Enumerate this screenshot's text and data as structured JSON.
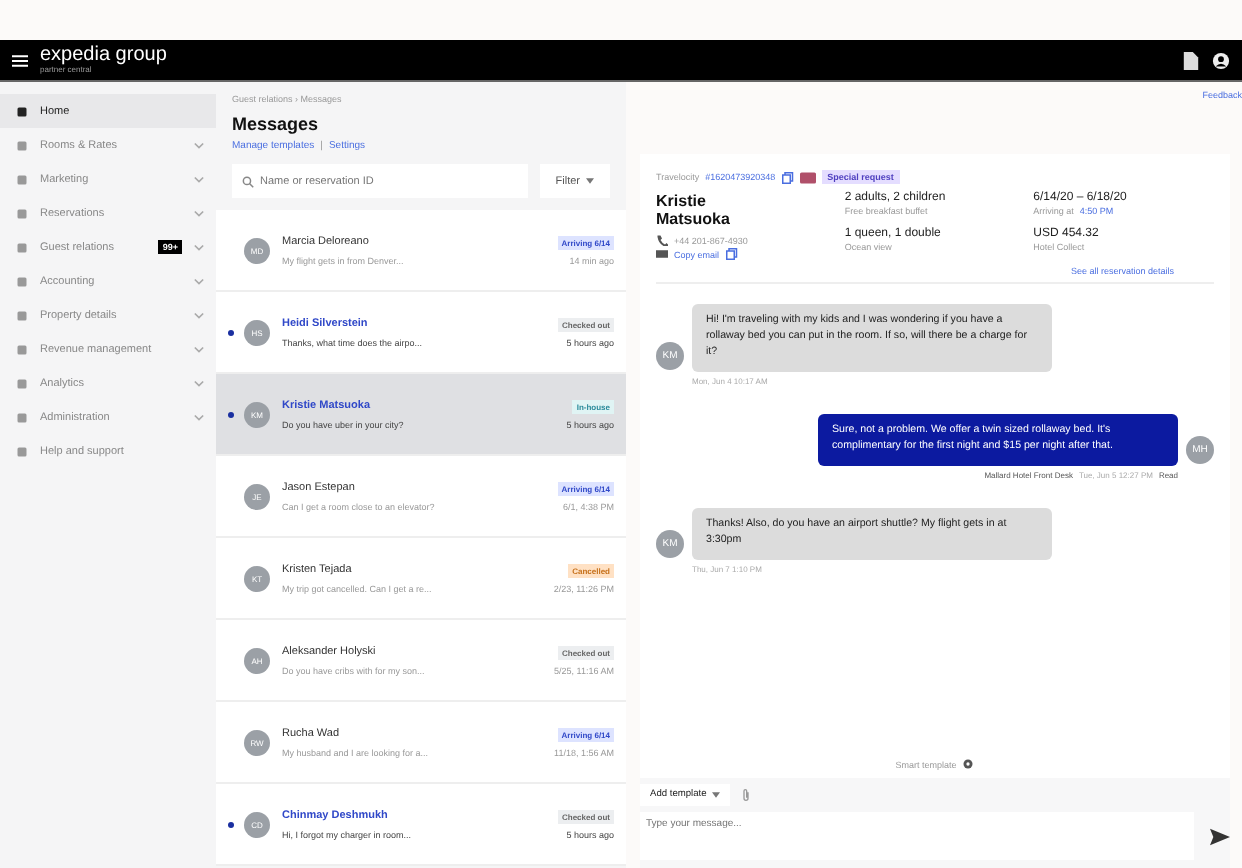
{
  "header": {
    "brand": "expedia group",
    "subtitle": "partner central"
  },
  "sidebar": {
    "items": [
      {
        "label": "Home",
        "selected": true,
        "expandable": false
      },
      {
        "label": "Rooms & Rates",
        "selected": false,
        "expandable": true
      },
      {
        "label": "Marketing",
        "selected": false,
        "expandable": true
      },
      {
        "label": "Reservations",
        "selected": false,
        "expandable": true
      },
      {
        "label": "Guest relations",
        "selected": false,
        "expandable": true,
        "badge": "99+"
      },
      {
        "label": "Accounting",
        "selected": false,
        "expandable": true
      },
      {
        "label": "Property details",
        "selected": false,
        "expandable": true
      },
      {
        "label": "Revenue management",
        "selected": false,
        "expandable": true
      },
      {
        "label": "Analytics",
        "selected": false,
        "expandable": true
      },
      {
        "label": "Administration",
        "selected": false,
        "expandable": true
      },
      {
        "label": "Help and support",
        "selected": false,
        "expandable": false
      }
    ]
  },
  "breadcrumb": "Guest relations › Messages",
  "feedback": "Feedback",
  "page_title": "Messages",
  "links": [
    "Manage templates",
    "Settings"
  ],
  "links_separator": "|",
  "search": {
    "placeholder": "Name or reservation ID"
  },
  "filter": "Filter",
  "conversations": [
    {
      "initials": "MD",
      "name": "Marcia Deloreano",
      "preview": "My flight gets in from Denver...",
      "status": "Arriving 6/14",
      "kind": "arriving",
      "time": "14 min ago",
      "unread": false,
      "selected": false
    },
    {
      "initials": "HS",
      "name": "Heidi Silverstein",
      "preview": "Thanks, what time does the airpo...",
      "status": "Checked out",
      "kind": "checked-out",
      "time": "5 hours ago",
      "unread": true,
      "selected": false
    },
    {
      "initials": "KM",
      "name": "Kristie Matsuoka",
      "preview": "Do you have uber in your city?",
      "status": "In-house",
      "kind": "in-house",
      "time": "5 hours ago",
      "unread": true,
      "selected": true
    },
    {
      "initials": "JE",
      "name": "Jason Estepan",
      "preview": "Can I get a room close to an elevator?",
      "status": "Arriving 6/14",
      "kind": "arriving",
      "time": "6/1, 4:38 PM",
      "unread": false,
      "selected": false
    },
    {
      "initials": "KT",
      "name": "Kristen Tejada",
      "preview": "My trip got cancelled. Can I get a re...",
      "status": "Cancelled",
      "kind": "cancelled",
      "time": "2/23, 11:26 PM",
      "unread": false,
      "selected": false
    },
    {
      "initials": "AH",
      "name": "Aleksander Holyski",
      "preview": "Do you have cribs with for my son...",
      "status": "Checked out",
      "kind": "checked-out",
      "time": "5/25, 11:16 AM",
      "unread": false,
      "selected": false
    },
    {
      "initials": "RW",
      "name": "Rucha Wad",
      "preview": "My husband and I are looking for a...",
      "status": "Arriving 6/14",
      "kind": "arriving",
      "time": "11/18, 1:56 AM",
      "unread": false,
      "selected": false
    },
    {
      "initials": "CD",
      "name": "Chinmay Deshmukh",
      "preview": "Hi, I forgot my charger in room...",
      "status": "Checked out",
      "kind": "checked-out",
      "time": "5 hours ago",
      "unread": true,
      "selected": false
    }
  ],
  "reservation": {
    "source": "Travelocity",
    "number": "#1620473920348",
    "tag": "Special request",
    "guest": "Kristie Matsuoka",
    "phone": "+44 201-867-4930",
    "email": "Copy email",
    "guests": "2 adults, 2 children",
    "meal": "Free breakfast buffet",
    "rooms": "1 queen, 1 double",
    "view": "Ocean view",
    "dates": "6/14/20 – 6/18/20",
    "arriving_label": "Arriving at",
    "arriving_time": "4:50 PM",
    "price": "USD 454.32",
    "payment": "Hotel Collect",
    "details_link": "See all reservation details"
  },
  "messages": [
    {
      "kind": "in",
      "initials": "KM",
      "text": "Hi! I'm traveling with my kids and I was wondering if you have a rollaway bed you can put in the room. If so, will there be a charge for it?",
      "meta": "Mon, Jun 4 10:17 AM"
    },
    {
      "kind": "out",
      "initials": "MH",
      "text": "Sure, not a problem. We offer a twin sized rollaway bed. It's complimentary for the first night and $15 per night after that.",
      "sender": "Mallard Hotel Front Desk",
      "meta": "Tue, Jun 5 12:27 PM",
      "receipt": "Read"
    },
    {
      "kind": "in",
      "initials": "KM",
      "text": "Thanks! Also, do you have an airport shuttle? My flight gets in at 3:30pm",
      "meta": "Thu, Jun 7 1:10 PM"
    }
  ],
  "smart_template": "Smart template",
  "add_template": "Add template",
  "composer": {
    "placeholder": "Type your message..."
  }
}
